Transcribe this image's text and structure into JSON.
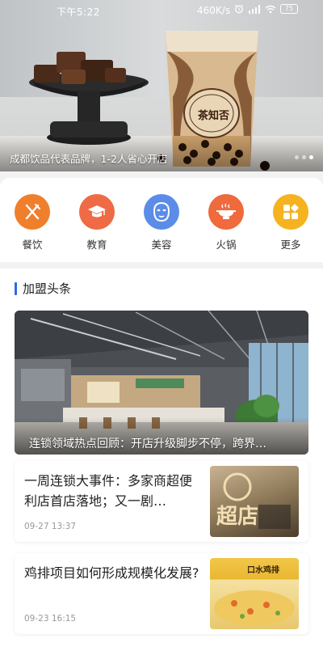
{
  "status_bar": {
    "time": "下午5:22",
    "net_speed": "460K/s",
    "battery": "75"
  },
  "banner": {
    "caption": "成都饮品代表品牌，1-2人省心开店",
    "cup_brand_text": "茶知否",
    "slide_count": 3,
    "active_slide": 3
  },
  "categories": [
    {
      "label": "餐饮",
      "icon": "utensils-icon",
      "color": "#f07f2c"
    },
    {
      "label": "教育",
      "icon": "graduation-cap-icon",
      "color": "#ee6b45"
    },
    {
      "label": "美容",
      "icon": "face-mask-icon",
      "color": "#5b8de8"
    },
    {
      "label": "火锅",
      "icon": "hotpot-icon",
      "color": "#ef6a3c"
    },
    {
      "label": "更多",
      "icon": "grid-more-icon",
      "color": "#f5b320"
    }
  ],
  "news_section": {
    "title": "加盟头条",
    "accent": "#2b6ce0",
    "featured": {
      "caption": "连锁领域热点回顾：开店升级脚步不停，跨界…"
    },
    "items": [
      {
        "title": "一周连锁大事件：多家商超便利店首店落地；又一剧…",
        "date": "09-27 13:37",
        "thumb_text": "超店"
      },
      {
        "title": "鸡排项目如何形成规模化发展?",
        "date": "09-23 16:15",
        "thumb_text": "口水鸡排"
      }
    ]
  }
}
